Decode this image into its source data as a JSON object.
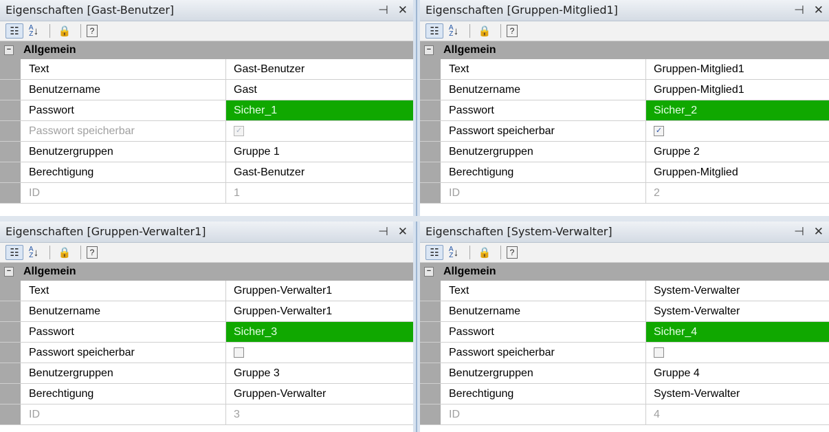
{
  "icons": {
    "categorized": "☷",
    "alphabetical": "↓",
    "lock": "🔒",
    "help": "?",
    "pin": "⊣",
    "close": "✕",
    "collapse": "−",
    "check": "✓"
  },
  "colors": {
    "password_highlight": "#10a800",
    "category_bg": "#a9a9a9"
  },
  "panels": [
    {
      "title": "Eigenschaften [Gast-Benutzer]",
      "category": "Allgemein",
      "rows": {
        "text": {
          "name": "Text",
          "value": "Gast-Benutzer"
        },
        "benutzername": {
          "name": "Benutzername",
          "value": "Gast"
        },
        "passwort": {
          "name": "Passwort",
          "value": "Sicher_1"
        },
        "speicherbar": {
          "name": "Passwort speicherbar",
          "checked": true,
          "disabled": true
        },
        "gruppen": {
          "name": "Benutzergruppen",
          "value": "Gruppe 1"
        },
        "berechtigung": {
          "name": "Berechtigung",
          "value": "Gast-Benutzer"
        },
        "id": {
          "name": "ID",
          "value": "1"
        }
      }
    },
    {
      "title": "Eigenschaften [Gruppen-Mitglied1]",
      "category": "Allgemein",
      "rows": {
        "text": {
          "name": "Text",
          "value": "Gruppen-Mitglied1"
        },
        "benutzername": {
          "name": "Benutzername",
          "value": "Gruppen-Mitglied1"
        },
        "passwort": {
          "name": "Passwort",
          "value": "Sicher_2"
        },
        "speicherbar": {
          "name": "Passwort speicherbar",
          "checked": true,
          "disabled": false
        },
        "gruppen": {
          "name": "Benutzergruppen",
          "value": "Gruppe 2"
        },
        "berechtigung": {
          "name": "Berechtigung",
          "value": "Gruppen-Mitglied"
        },
        "id": {
          "name": "ID",
          "value": "2"
        }
      }
    },
    {
      "title": "Eigenschaften [Gruppen-Verwalter1]",
      "category": "Allgemein",
      "rows": {
        "text": {
          "name": "Text",
          "value": "Gruppen-Verwalter1"
        },
        "benutzername": {
          "name": "Benutzername",
          "value": "Gruppen-Verwalter1"
        },
        "passwort": {
          "name": "Passwort",
          "value": "Sicher_3"
        },
        "speicherbar": {
          "name": "Passwort speicherbar",
          "checked": false,
          "disabled": false
        },
        "gruppen": {
          "name": "Benutzergruppen",
          "value": "Gruppe 3"
        },
        "berechtigung": {
          "name": "Berechtigung",
          "value": "Gruppen-Verwalter"
        },
        "id": {
          "name": "ID",
          "value": "3"
        }
      }
    },
    {
      "title": "Eigenschaften [System-Verwalter]",
      "category": "Allgemein",
      "rows": {
        "text": {
          "name": "Text",
          "value": "System-Verwalter"
        },
        "benutzername": {
          "name": "Benutzername",
          "value": "System-Verwalter"
        },
        "passwort": {
          "name": "Passwort",
          "value": "Sicher_4"
        },
        "speicherbar": {
          "name": "Passwort speicherbar",
          "checked": false,
          "disabled": false
        },
        "gruppen": {
          "name": "Benutzergruppen",
          "value": "Gruppe 4"
        },
        "berechtigung": {
          "name": "Berechtigung",
          "value": "System-Verwalter"
        },
        "id": {
          "name": "ID",
          "value": "4"
        }
      }
    }
  ]
}
